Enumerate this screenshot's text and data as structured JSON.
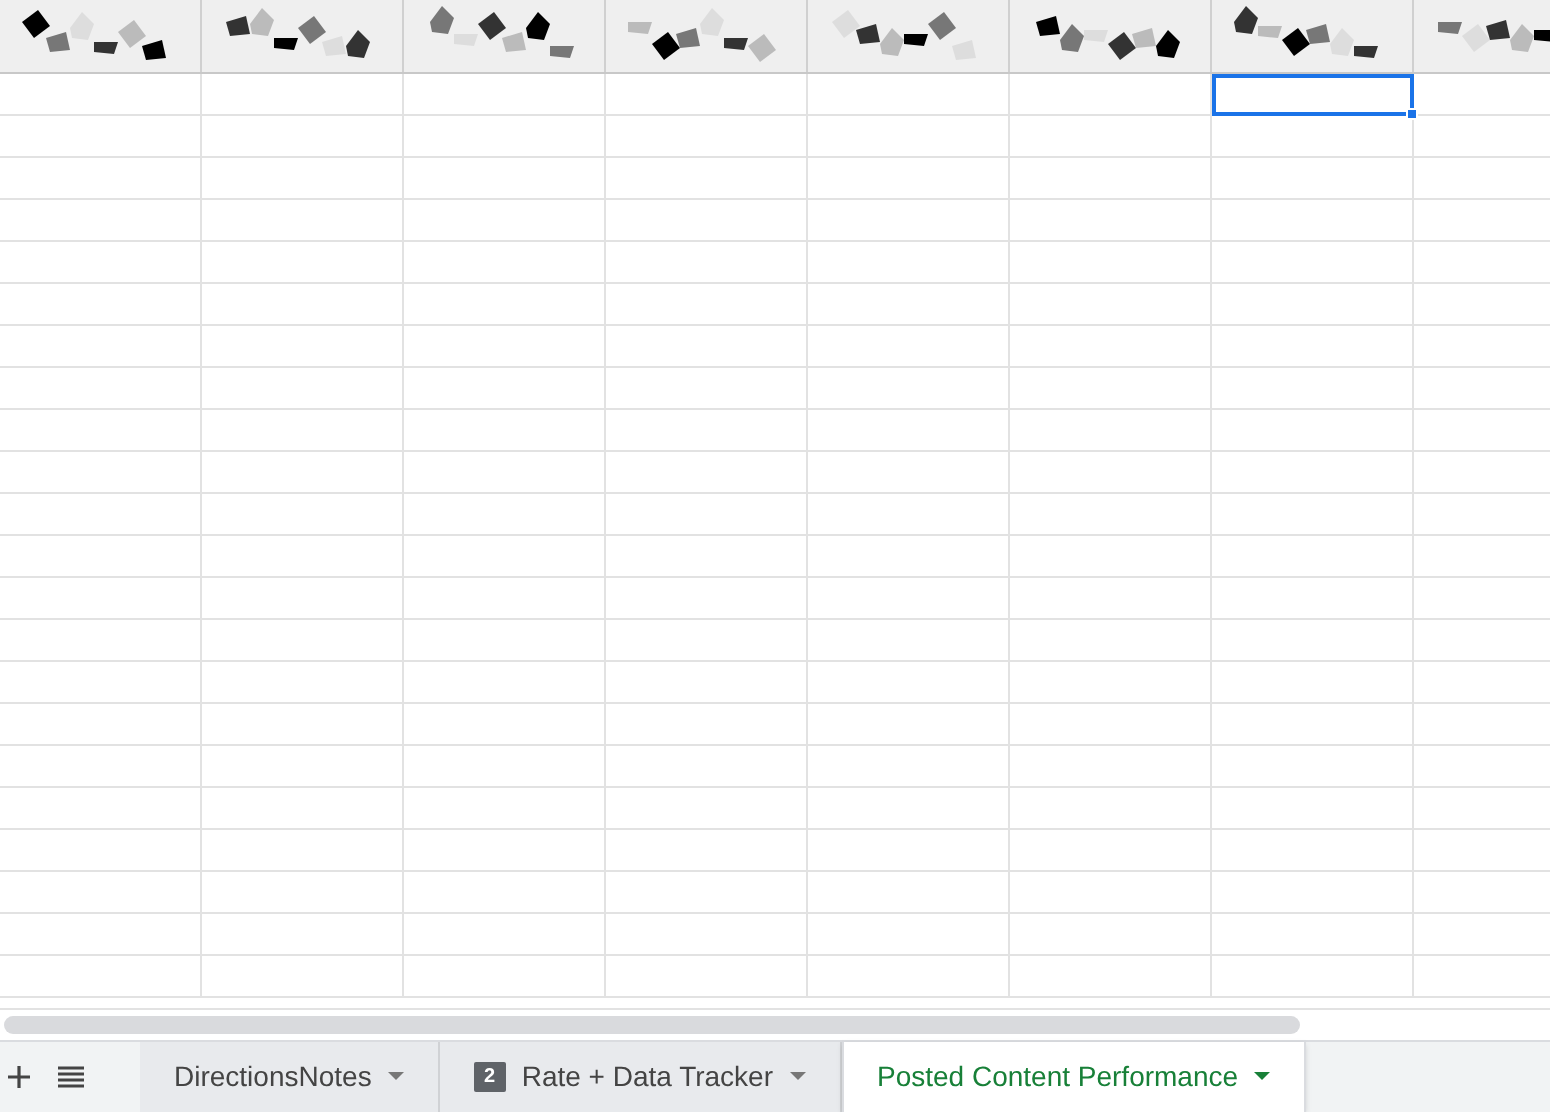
{
  "header_cells": [
    {
      "kind": "obscured"
    },
    {
      "kind": "obscured"
    },
    {
      "kind": "obscured"
    },
    {
      "kind": "obscured"
    },
    {
      "kind": "obscured"
    },
    {
      "kind": "obscured"
    },
    {
      "kind": "obscured"
    },
    {
      "kind": "obscured"
    }
  ],
  "rows": [
    {
      "cells": [
        {
          "selected": false
        },
        {
          "selected": false
        },
        {
          "selected": false
        },
        {
          "selected": false
        },
        {
          "selected": false
        },
        {
          "selected": false
        },
        {
          "selected": true
        },
        {
          "selected": false
        }
      ]
    },
    {
      "cells": [
        {
          "selected": false
        },
        {
          "selected": false
        },
        {
          "selected": false
        },
        {
          "selected": false
        },
        {
          "selected": false
        },
        {
          "selected": false
        },
        {
          "selected": false
        },
        {
          "selected": false
        }
      ]
    },
    {
      "cells": [
        {
          "selected": false
        },
        {
          "selected": false
        },
        {
          "selected": false
        },
        {
          "selected": false
        },
        {
          "selected": false
        },
        {
          "selected": false
        },
        {
          "selected": false
        },
        {
          "selected": false
        }
      ]
    },
    {
      "cells": [
        {
          "selected": false
        },
        {
          "selected": false
        },
        {
          "selected": false
        },
        {
          "selected": false
        },
        {
          "selected": false
        },
        {
          "selected": false
        },
        {
          "selected": false
        },
        {
          "selected": false
        }
      ]
    },
    {
      "cells": [
        {
          "selected": false
        },
        {
          "selected": false
        },
        {
          "selected": false
        },
        {
          "selected": false
        },
        {
          "selected": false
        },
        {
          "selected": false
        },
        {
          "selected": false
        },
        {
          "selected": false
        }
      ]
    },
    {
      "cells": [
        {
          "selected": false
        },
        {
          "selected": false
        },
        {
          "selected": false
        },
        {
          "selected": false
        },
        {
          "selected": false
        },
        {
          "selected": false
        },
        {
          "selected": false
        },
        {
          "selected": false
        }
      ]
    },
    {
      "cells": [
        {
          "selected": false
        },
        {
          "selected": false
        },
        {
          "selected": false
        },
        {
          "selected": false
        },
        {
          "selected": false
        },
        {
          "selected": false
        },
        {
          "selected": false
        },
        {
          "selected": false
        }
      ]
    },
    {
      "cells": [
        {
          "selected": false
        },
        {
          "selected": false
        },
        {
          "selected": false
        },
        {
          "selected": false
        },
        {
          "selected": false
        },
        {
          "selected": false
        },
        {
          "selected": false
        },
        {
          "selected": false
        }
      ]
    },
    {
      "cells": [
        {
          "selected": false
        },
        {
          "selected": false
        },
        {
          "selected": false
        },
        {
          "selected": false
        },
        {
          "selected": false
        },
        {
          "selected": false
        },
        {
          "selected": false
        },
        {
          "selected": false
        }
      ]
    },
    {
      "cells": [
        {
          "selected": false
        },
        {
          "selected": false
        },
        {
          "selected": false
        },
        {
          "selected": false
        },
        {
          "selected": false
        },
        {
          "selected": false
        },
        {
          "selected": false
        },
        {
          "selected": false
        }
      ]
    },
    {
      "cells": [
        {
          "selected": false
        },
        {
          "selected": false
        },
        {
          "selected": false
        },
        {
          "selected": false
        },
        {
          "selected": false
        },
        {
          "selected": false
        },
        {
          "selected": false
        },
        {
          "selected": false
        }
      ]
    },
    {
      "cells": [
        {
          "selected": false
        },
        {
          "selected": false
        },
        {
          "selected": false
        },
        {
          "selected": false
        },
        {
          "selected": false
        },
        {
          "selected": false
        },
        {
          "selected": false
        },
        {
          "selected": false
        }
      ]
    },
    {
      "cells": [
        {
          "selected": false
        },
        {
          "selected": false
        },
        {
          "selected": false
        },
        {
          "selected": false
        },
        {
          "selected": false
        },
        {
          "selected": false
        },
        {
          "selected": false
        },
        {
          "selected": false
        }
      ]
    },
    {
      "cells": [
        {
          "selected": false
        },
        {
          "selected": false
        },
        {
          "selected": false
        },
        {
          "selected": false
        },
        {
          "selected": false
        },
        {
          "selected": false
        },
        {
          "selected": false
        },
        {
          "selected": false
        }
      ]
    },
    {
      "cells": [
        {
          "selected": false
        },
        {
          "selected": false
        },
        {
          "selected": false
        },
        {
          "selected": false
        },
        {
          "selected": false
        },
        {
          "selected": false
        },
        {
          "selected": false
        },
        {
          "selected": false
        }
      ]
    },
    {
      "cells": [
        {
          "selected": false
        },
        {
          "selected": false
        },
        {
          "selected": false
        },
        {
          "selected": false
        },
        {
          "selected": false
        },
        {
          "selected": false
        },
        {
          "selected": false
        },
        {
          "selected": false
        }
      ]
    },
    {
      "cells": [
        {
          "selected": false
        },
        {
          "selected": false
        },
        {
          "selected": false
        },
        {
          "selected": false
        },
        {
          "selected": false
        },
        {
          "selected": false
        },
        {
          "selected": false
        },
        {
          "selected": false
        }
      ]
    },
    {
      "cells": [
        {
          "selected": false
        },
        {
          "selected": false
        },
        {
          "selected": false
        },
        {
          "selected": false
        },
        {
          "selected": false
        },
        {
          "selected": false
        },
        {
          "selected": false
        },
        {
          "selected": false
        }
      ]
    },
    {
      "cells": [
        {
          "selected": false
        },
        {
          "selected": false
        },
        {
          "selected": false
        },
        {
          "selected": false
        },
        {
          "selected": false
        },
        {
          "selected": false
        },
        {
          "selected": false
        },
        {
          "selected": false
        }
      ]
    },
    {
      "cells": [
        {
          "selected": false
        },
        {
          "selected": false
        },
        {
          "selected": false
        },
        {
          "selected": false
        },
        {
          "selected": false
        },
        {
          "selected": false
        },
        {
          "selected": false
        },
        {
          "selected": false
        }
      ]
    },
    {
      "cells": [
        {
          "selected": false
        },
        {
          "selected": false
        },
        {
          "selected": false
        },
        {
          "selected": false
        },
        {
          "selected": false
        },
        {
          "selected": false
        },
        {
          "selected": false
        },
        {
          "selected": false
        }
      ]
    },
    {
      "cells": [
        {
          "selected": false
        },
        {
          "selected": false
        },
        {
          "selected": false
        },
        {
          "selected": false
        },
        {
          "selected": false
        },
        {
          "selected": false
        },
        {
          "selected": false
        },
        {
          "selected": false
        }
      ]
    }
  ],
  "sheet_tabs": [
    {
      "label": "DirectionsNotes",
      "selected": false
    },
    {
      "label": "Rate + Data Tracker",
      "selected": false,
      "comment_count": "2"
    },
    {
      "label": "Posted Content Performance",
      "selected": true
    }
  ]
}
